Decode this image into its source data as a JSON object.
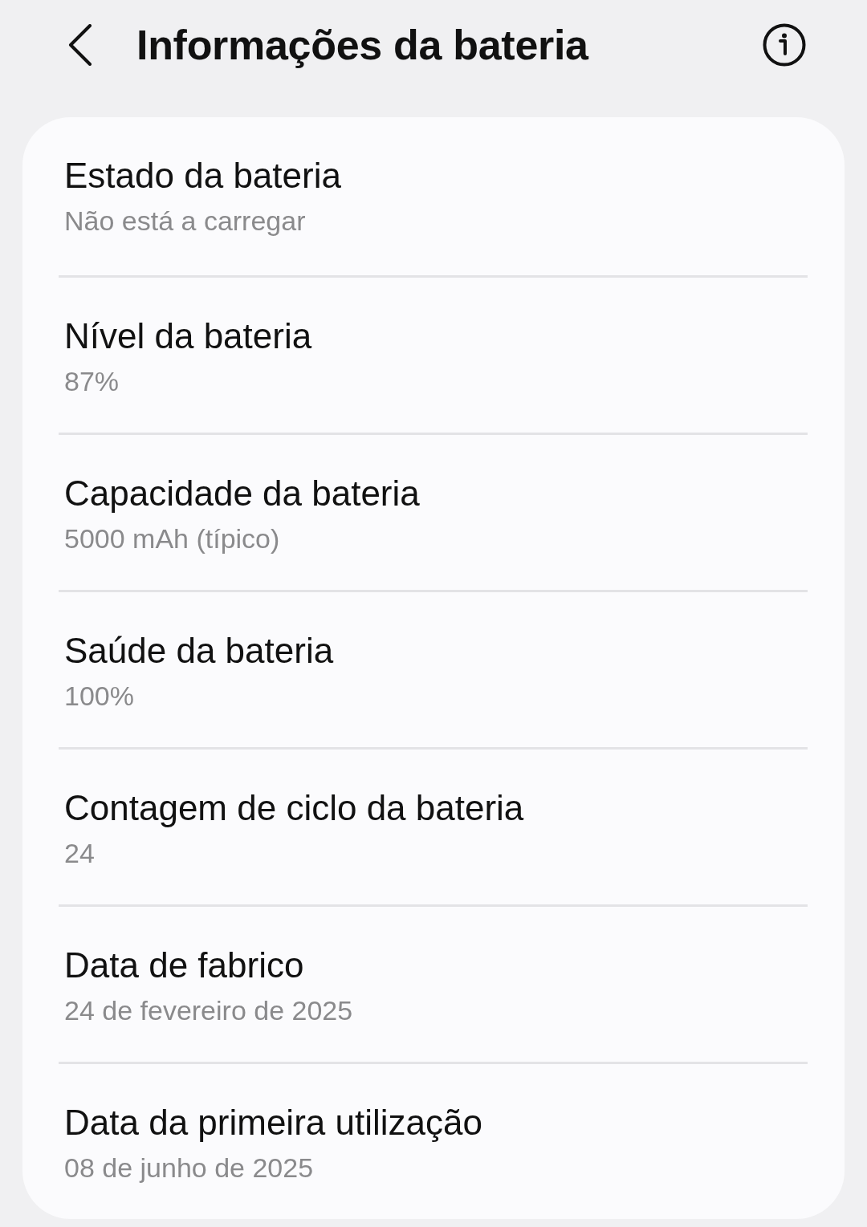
{
  "header": {
    "title": "Informações da bateria"
  },
  "items": [
    {
      "title": "Estado da bateria",
      "value": "Não está a carregar"
    },
    {
      "title": "Nível da bateria",
      "value": "87%"
    },
    {
      "title": "Capacidade da bateria",
      "value": "5000 mAh (típico)"
    },
    {
      "title": "Saúde da bateria",
      "value": "100%"
    },
    {
      "title": "Contagem de ciclo da bateria",
      "value": "24"
    },
    {
      "title": "Data de fabrico",
      "value": "24 de fevereiro de 2025"
    },
    {
      "title": "Data da primeira utilização",
      "value": "08 de junho de 2025"
    }
  ]
}
